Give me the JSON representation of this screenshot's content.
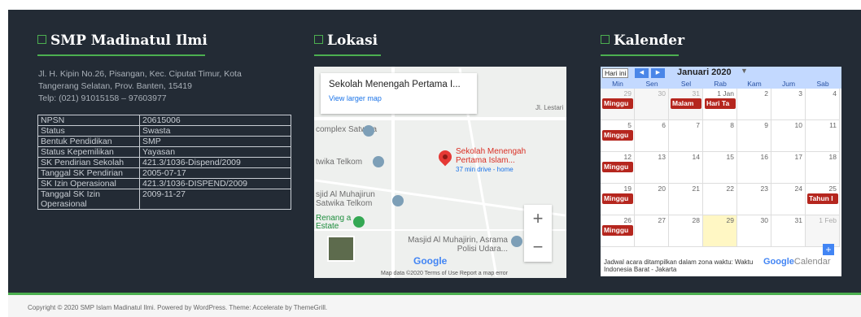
{
  "footer_widgets": {
    "school": {
      "title": "SMP Madinatul Ilmi",
      "address_line1": "Jl. H. Kipin No.26, Pisangan, Kec. Ciputat Timur, Kota",
      "address_line2": "Tangerang Selatan, Prov. Banten, 15419",
      "phone": "Telp: (021) 91015158 – 97603977",
      "info_rows": [
        {
          "key": "NPSN",
          "value": "20615006"
        },
        {
          "key": "Status",
          "value": "Swasta"
        },
        {
          "key": "Bentuk Pendidikan",
          "value": "SMP"
        },
        {
          "key": "Status Kepemilikan",
          "value": "Yayasan"
        },
        {
          "key": "SK Pendirian Sekolah",
          "value": "421.3/1036-Dispend/2009"
        },
        {
          "key": "Tanggal SK Pendirian",
          "value": "2005-07-17"
        },
        {
          "key": "SK Izin Operasional",
          "value": "421.3/1036-DISPEND/2009"
        },
        {
          "key": "Tanggal SK Izin Operasional",
          "value": "2009-11-27"
        }
      ]
    },
    "location": {
      "title": "Lokasi",
      "card_title": "Sekolah Menengah Pertama I...",
      "card_link": "View larger map",
      "labels": [
        "complex Satwika",
        "twika Telkom",
        "sjid Al Muhajirun Satwika Telkom",
        "Renang a Estate",
        "Masjid Al Muhajirin, Asrama Polisi Udara...",
        "Jl. Lestari"
      ],
      "place_name_1": "Sekolah Menengah",
      "place_name_2": "Pertama Islam...",
      "place_sub": "37 min drive - home",
      "google": "Google",
      "footer": "Map data ©2020   Terms of Use   Report a map error",
      "zoom_in": "+",
      "zoom_out": "−"
    },
    "calendar": {
      "title": "Kalender",
      "today_btn": "Hari ini",
      "prev": "◀",
      "next": "▶",
      "month": "Januari 2020",
      "dropdown": "▼",
      "days": [
        "Min",
        "Sen",
        "Sel",
        "Rab",
        "Kam",
        "Jum",
        "Sab"
      ],
      "weeks": [
        [
          "29",
          "30",
          "31",
          "1 Jan",
          "2",
          "3",
          "4"
        ],
        [
          "5",
          "6",
          "7",
          "8",
          "9",
          "10",
          "11"
        ],
        [
          "12",
          "13",
          "14",
          "15",
          "16",
          "17",
          "18"
        ],
        [
          "19",
          "20",
          "21",
          "22",
          "23",
          "24",
          "25"
        ],
        [
          "26",
          "27",
          "28",
          "29",
          "30",
          "31",
          "1 Feb"
        ]
      ],
      "events": {
        "minggu": "Minggu",
        "malam": "Malam",
        "hari_ta": "Hari Ta",
        "tahun": "Tahun I"
      },
      "footer_note": "Jadwal acara ditampilkan dalam zona waktu: Waktu Indonesia Barat - Jakarta",
      "gcal_google": "Google",
      "gcal_calendar": "Calendar",
      "add": "+"
    }
  },
  "footer": {
    "copyright": "Copyright © 2020 SMP Islam Madinatul Ilmi. Powered by WordPress. Theme: Accelerate by ThemeGrill."
  },
  "colors": {
    "background": "#232b35",
    "accent": "#4caf50",
    "event": "#b5261e"
  }
}
